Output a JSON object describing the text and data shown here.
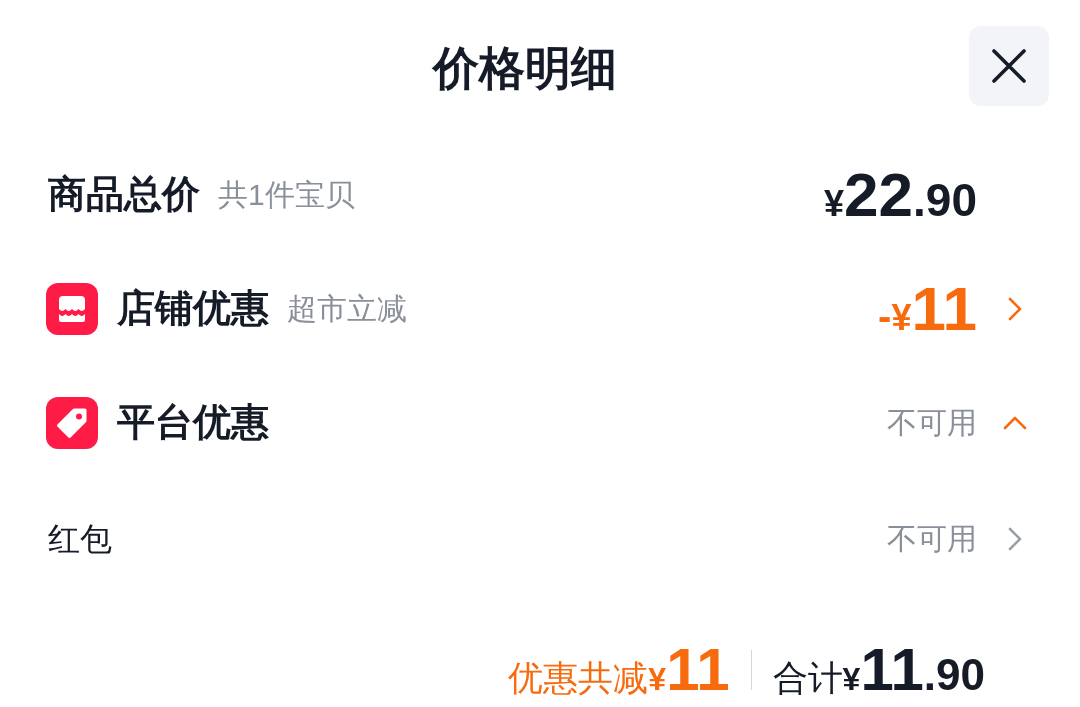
{
  "title": "价格明细",
  "rows": [
    {
      "kind": "total",
      "label": "商品总价",
      "note": "共1件宝贝",
      "price": {
        "currency": "¥",
        "whole": "22",
        "fraction": ".90"
      }
    },
    {
      "kind": "shop",
      "label": "店铺优惠",
      "note": "超市立减",
      "expanded": false,
      "discount": {
        "sign": "-",
        "currency": "¥",
        "whole": "11"
      }
    },
    {
      "kind": "platform",
      "label": "平台优惠",
      "expanded": true,
      "status": "不可用",
      "children": [
        {
          "label": "红包",
          "status": "不可用"
        }
      ]
    }
  ],
  "footer": {
    "discount_label": "优惠共减",
    "discount": {
      "currency": "¥",
      "whole": "11"
    },
    "total_label": "合计",
    "total": {
      "currency": "¥",
      "whole": "11",
      "fraction": ".90"
    }
  }
}
